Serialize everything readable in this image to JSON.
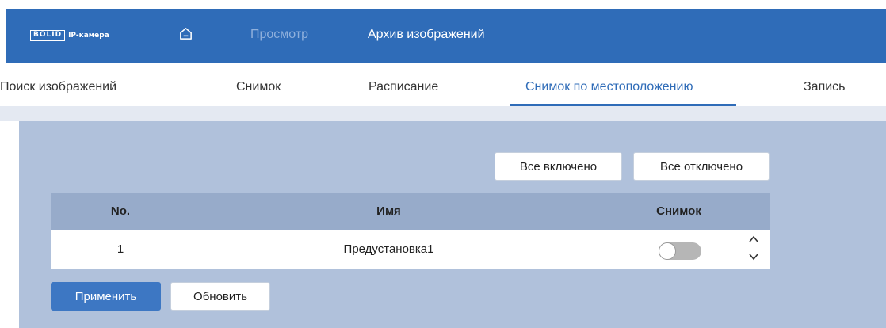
{
  "brand": {
    "logo": "BOLID",
    "subtitle": "IP-камера"
  },
  "nav": {
    "view": "Просмотр",
    "archive": "Архив изображений"
  },
  "tabs": [
    {
      "label": "Поиск изображений",
      "active": false
    },
    {
      "label": "Снимок",
      "active": false
    },
    {
      "label": "Расписание",
      "active": false
    },
    {
      "label": "Снимок по местоположению",
      "active": true
    },
    {
      "label": "Запись",
      "active": false
    }
  ],
  "actions": {
    "all_on": "Все включено",
    "all_off": "Все отключено"
  },
  "table": {
    "columns": [
      "No.",
      "Имя",
      "Снимок"
    ],
    "rows": [
      {
        "no": "1",
        "name": "Предустановка1",
        "snapshot_enabled": false
      }
    ]
  },
  "footer": {
    "apply": "Применить",
    "refresh": "Обновить"
  },
  "colors": {
    "primary": "#2f6cb8",
    "panel": "#b0c1db",
    "header": "#97abca"
  }
}
